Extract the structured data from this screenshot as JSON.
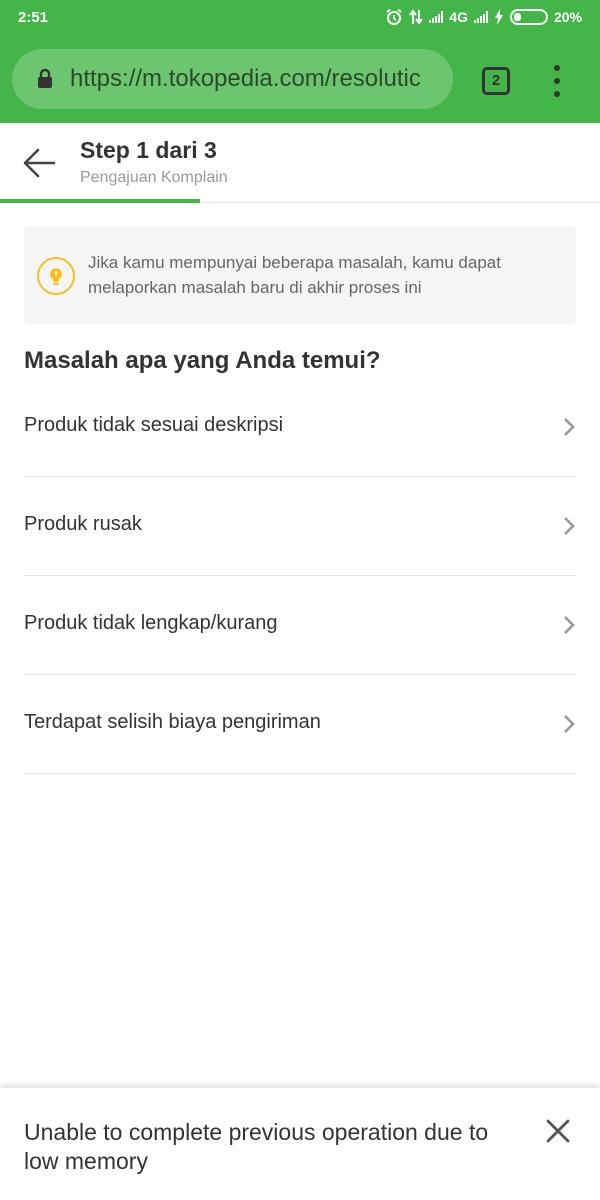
{
  "status_bar": {
    "time": "2:51",
    "network": "4G",
    "battery": "20%"
  },
  "browser": {
    "url_host": "https://m.tokopedia.com/resolutic",
    "tab_count": "2"
  },
  "header": {
    "step_title": "Step 1 dari 3",
    "step_subtitle": "Pengajuan Komplain",
    "progress_fraction": 0.333
  },
  "info_box": {
    "text": "Jika kamu mempunyai beberapa masalah, kamu dapat melaporkan masalah baru di akhir proses ini"
  },
  "question": "Masalah apa yang Anda temui?",
  "problems": [
    {
      "label": "Produk tidak sesuai deskripsi"
    },
    {
      "label": "Produk rusak"
    },
    {
      "label": "Produk tidak lengkap/kurang"
    },
    {
      "label": "Terdapat selisih biaya pengiriman"
    }
  ],
  "snackbar": {
    "message": "Unable to complete previous operation due to low memory"
  },
  "colors": {
    "brand_green": "#44b549",
    "bulb_yellow": "#f5c021"
  },
  "icons": {
    "status": [
      "alarm-icon",
      "data-transfer-icon",
      "signal-icon",
      "charging-icon",
      "battery-icon"
    ],
    "browser": [
      "lock-icon",
      "tab-switcher-icon",
      "overflow-menu-icon"
    ],
    "header": [
      "back-arrow-icon"
    ],
    "info": [
      "lightbulb-icon"
    ],
    "list": [
      "chevron-right-icon"
    ],
    "snackbar": [
      "close-icon"
    ]
  }
}
